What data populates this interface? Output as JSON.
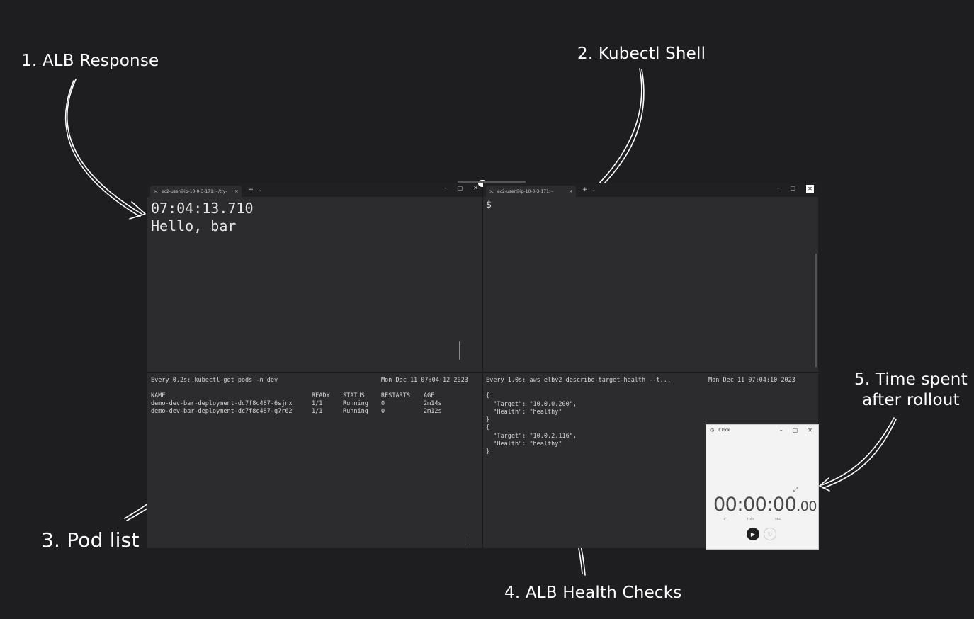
{
  "annotations": {
    "a1": "1. ALB Response",
    "a2": "2. Kubectl Shell",
    "a3": "3. Pod list",
    "a4": "4. ALB Health Checks",
    "a5_line1": "5. Time spent",
    "a5_line2": "after rollout"
  },
  "left_window": {
    "tab_title": "ec2-user@ip-10-0-3-171:~/try-",
    "tab_close": "✕",
    "new_tab": "+",
    "dropdown": "⌄",
    "controls": {
      "minimize": "–",
      "maximize": "▢",
      "close": "✕"
    },
    "top_pane": {
      "lines": [
        "07:04:13.710",
        "Hello, bar"
      ]
    },
    "bottom_pane": {
      "header_cmd": "Every 0.2s: kubectl get pods -n dev",
      "header_time": "Mon Dec 11 07:04:12 2023",
      "columns": [
        "NAME",
        "READY",
        "STATUS",
        "RESTARTS",
        "AGE"
      ],
      "rows": [
        [
          "demo-dev-bar-deployment-dc7f8c487-6sjnx",
          "1/1",
          "Running",
          "0",
          "2m14s"
        ],
        [
          "demo-dev-bar-deployment-dc7f8c487-g7r62",
          "1/1",
          "Running",
          "0",
          "2m12s"
        ]
      ]
    }
  },
  "right_window": {
    "tab_title": "ec2-user@ip-10-0-3-171:~",
    "tab_close": "✕",
    "new_tab": "+",
    "dropdown": "⌄",
    "controls": {
      "minimize": "–",
      "maximize": "▢",
      "close": "✕"
    },
    "top_pane": {
      "prompt": "$"
    },
    "bottom_pane": {
      "header_cmd": "Every 1.0s: aws elbv2 describe-target-health --t...",
      "header_time": "Mon Dec 11 07:04:10 2023",
      "json_lines": [
        "{",
        "  \"Target\": \"10.0.0.200\",",
        "  \"Health\": \"healthy\"",
        "}",
        "{",
        "  \"Target\": \"10.0.2.116\",",
        "  \"Health\": \"healthy\"",
        "}"
      ]
    }
  },
  "clock": {
    "title": "Clock",
    "controls": {
      "minimize": "–",
      "maximize": "▢",
      "close": "✕"
    },
    "time_main": "00:00:00",
    "time_cs": ".00",
    "units": {
      "hr": "hr",
      "min": "min",
      "sec": "sec"
    }
  }
}
